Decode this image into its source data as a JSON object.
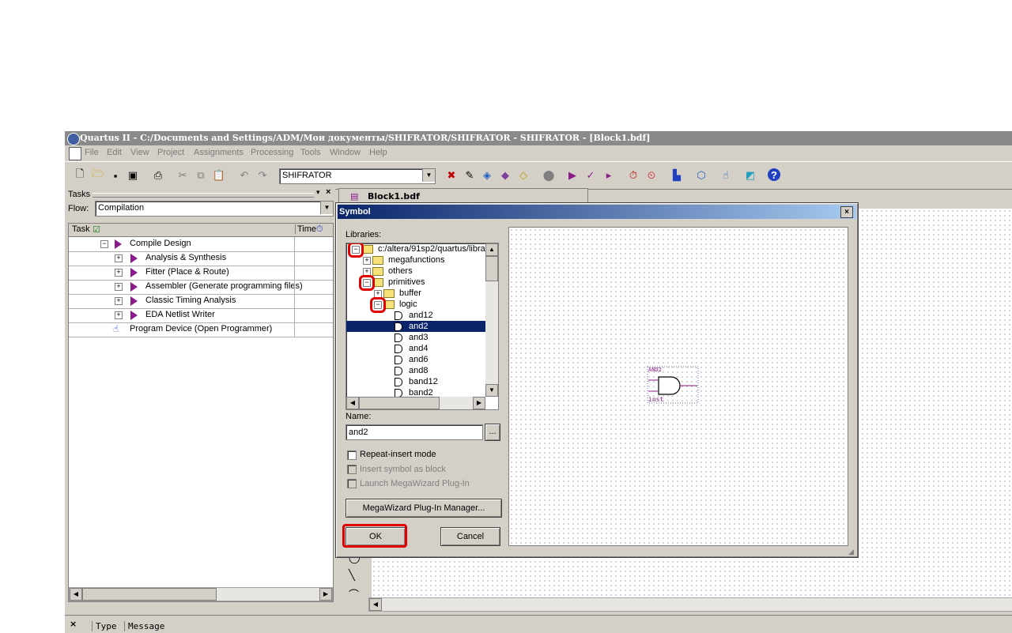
{
  "window": {
    "title": "Quartus II - C:/Documents and Settings/ADM/Мои документы/SHIFRATOR/SHIFRATOR - SHIFRATOR - [Block1.bdf]"
  },
  "menu": [
    "File",
    "Edit",
    "View",
    "Project",
    "Assignments",
    "Processing",
    "Tools",
    "Window",
    "Help"
  ],
  "toolbar": {
    "project_combo_value": "SHIFRATOR"
  },
  "tasks_panel": {
    "title": "Tasks",
    "flow_label": "Flow:",
    "flow_value": "Compilation",
    "columns": [
      "Task",
      "Time"
    ],
    "rows": [
      {
        "label": "Compile Design",
        "kind": "group"
      },
      {
        "label": "Analysis & Synthesis",
        "kind": "task"
      },
      {
        "label": "Fitter (Place & Route)",
        "kind": "task"
      },
      {
        "label": "Assembler (Generate programming files)",
        "kind": "task"
      },
      {
        "label": "Classic Timing Analysis",
        "kind": "task"
      },
      {
        "label": "EDA Netlist Writer",
        "kind": "task"
      },
      {
        "label": "Program Device (Open Programmer)",
        "kind": "program"
      }
    ]
  },
  "document_tab": {
    "label": "Block1.bdf"
  },
  "symbol_dialog": {
    "title": "Symbol",
    "libraries_label": "Libraries:",
    "tree": [
      {
        "label": "c:/altera/91sp2/quartus/libra",
        "level": 0,
        "expander": "−",
        "icon": "folder-open",
        "highlight": true
      },
      {
        "label": "megafunctions",
        "level": 1,
        "expander": "+",
        "icon": "folder"
      },
      {
        "label": "others",
        "level": 1,
        "expander": "+",
        "icon": "folder"
      },
      {
        "label": "primitives",
        "level": 1,
        "expander": "−",
        "icon": "folder-open",
        "highlight": true
      },
      {
        "label": "buffer",
        "level": 2,
        "expander": "+",
        "icon": "folder"
      },
      {
        "label": "logic",
        "level": 2,
        "expander": "−",
        "icon": "folder-open",
        "highlight": true
      },
      {
        "label": "and12",
        "level": 3,
        "icon": "gate"
      },
      {
        "label": "and2",
        "level": 3,
        "icon": "gate",
        "selected": true
      },
      {
        "label": "and3",
        "level": 3,
        "icon": "gate"
      },
      {
        "label": "and4",
        "level": 3,
        "icon": "gate"
      },
      {
        "label": "and6",
        "level": 3,
        "icon": "gate"
      },
      {
        "label": "and8",
        "level": 3,
        "icon": "gate"
      },
      {
        "label": "band12",
        "level": 3,
        "icon": "gate"
      },
      {
        "label": "band2",
        "level": 3,
        "icon": "gate"
      }
    ],
    "name_label": "Name:",
    "name_value": "and2",
    "browse_label": "...",
    "options": [
      {
        "label": "Repeat-insert mode",
        "enabled": true,
        "checked": false
      },
      {
        "label": "Insert symbol as block",
        "enabled": false,
        "checked": false
      },
      {
        "label": "Launch MegaWizard Plug-In",
        "enabled": false,
        "checked": false
      }
    ],
    "megawizard_button": "MegaWizard Plug-In Manager...",
    "ok_button": "OK",
    "cancel_button": "Cancel",
    "preview": {
      "symbol_name": "AND2",
      "instance_name": "inst"
    }
  },
  "message_panel": {
    "columns": [
      "Type",
      "Message"
    ]
  },
  "colors": {
    "selection": "#0a246a",
    "highlight_annotation": "#e00000",
    "task_arrow": "#8b1a8b"
  }
}
